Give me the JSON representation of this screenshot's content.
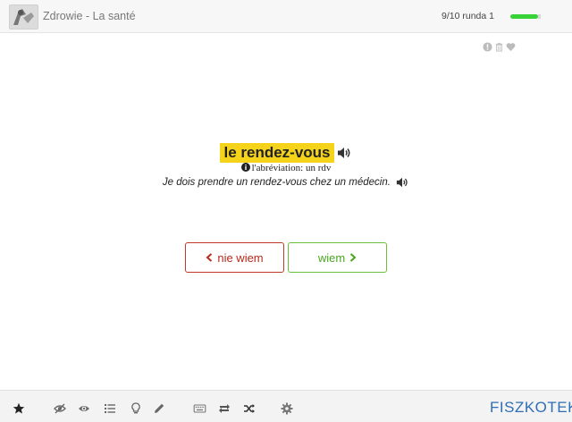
{
  "header": {
    "deck_title": "Zdrowie - La santé",
    "progress_text": "9/10 runda 1",
    "progress_fraction": 0.9
  },
  "card": {
    "word": "le rendez-vous",
    "note": "l'abréviation: un rdv",
    "sentence": "Je dois prendre un rendez-vous chez un médecin.",
    "top_icons": [
      "info-icon",
      "trash-icon",
      "heart-icon"
    ]
  },
  "actions": {
    "dont_know_label": "nie wiem",
    "know_label": "wiem"
  },
  "footer": {
    "icons": [
      "star-icon",
      "eye-slash-icon",
      "eye-icon",
      "list-icon",
      "lightbulb-icon",
      "pencil-icon",
      "keyboard-icon",
      "repeat-icon",
      "shuffle-icon",
      "gear-icon"
    ],
    "brand": "FISZKOTEKA"
  },
  "colors": {
    "highlight": "#f5d31a",
    "no_red": "#c0392b",
    "yes_green": "#6cbf3c",
    "progress_green": "#37d337",
    "brand_blue": "#2f6eb5"
  }
}
